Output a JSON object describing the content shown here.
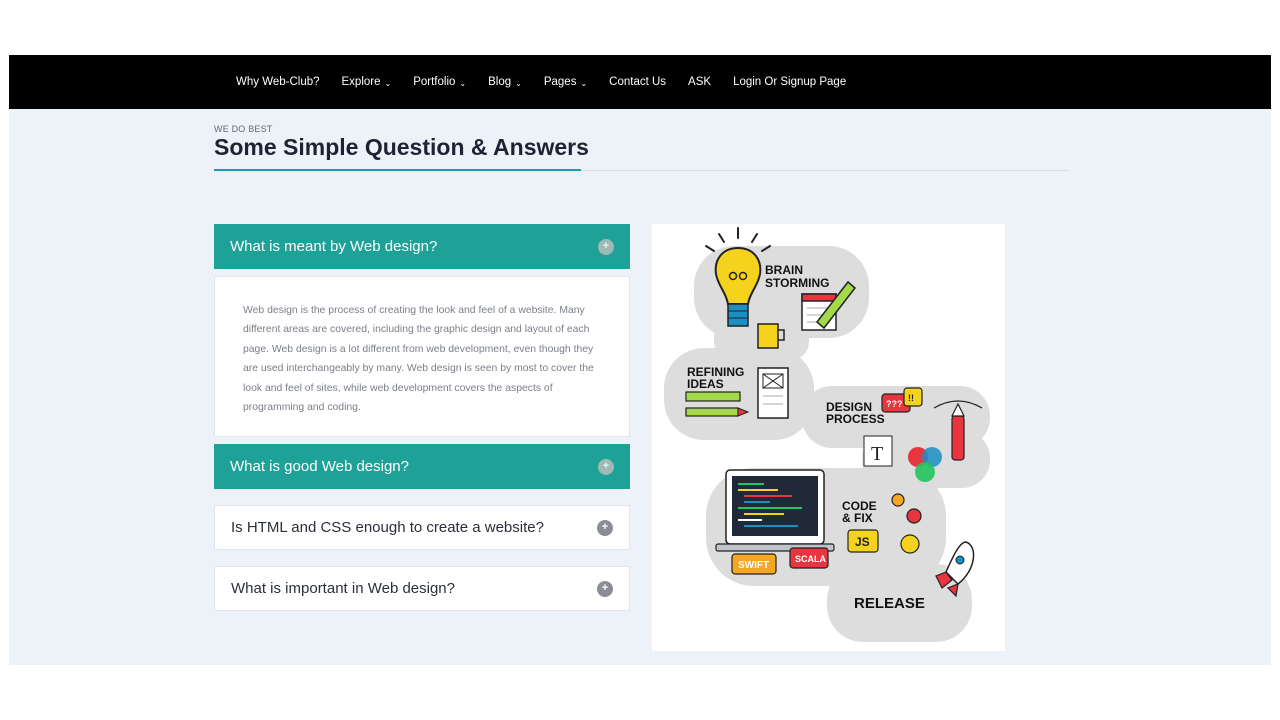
{
  "nav": {
    "items": [
      {
        "label": "Why Web-Club?",
        "dropdown": false
      },
      {
        "label": "Explore",
        "dropdown": true
      },
      {
        "label": "Portfolio",
        "dropdown": true
      },
      {
        "label": "Blog",
        "dropdown": true
      },
      {
        "label": "Pages",
        "dropdown": true
      },
      {
        "label": "Contact Us",
        "dropdown": false
      },
      {
        "label": "ASK",
        "dropdown": false
      },
      {
        "label": "Login Or Signup Page",
        "dropdown": false
      }
    ],
    "caret": "⌄"
  },
  "section": {
    "eyebrow": "WE DO BEST",
    "title": "Some Simple Question & Answers"
  },
  "faq": {
    "items": [
      {
        "question": "What is meant by Web design?",
        "expanded": true
      },
      {
        "question": "What is good Web design?",
        "expanded": false
      },
      {
        "question": "Is HTML and CSS enough to create a website?",
        "expanded": false
      },
      {
        "question": "What is important in Web design?",
        "expanded": false
      }
    ],
    "answer_lines": [
      "Web design is the process of creating the look and feel of a website. Many",
      "different areas are covered, including the graphic design and layout of each",
      "page. Web design is a lot different from web development, even though they",
      "are used interchangeably by many. Web design is seen by most to cover the",
      "look and feel of sites, while web development covers the aspects of",
      "programming and coding."
    ],
    "toggle_glyph": "+"
  },
  "illustration": {
    "labels": {
      "brainstorming_1": "BRAIN",
      "brainstorming_2": "STORMING",
      "refining_1": "REFINING",
      "refining_2": "IDEAS",
      "design_1": "DESIGN",
      "design_2": "PROCESS",
      "bubble": "???",
      "bubble2": "!!",
      "text_tool": "T",
      "code_1": "CODE",
      "code_2": "& FIX",
      "js": "JS",
      "swift": "SWIFT",
      "scala": "SCALA",
      "release": "RELEASE"
    },
    "colors": {
      "blob": "#dddddd",
      "yellow": "#f5d21c",
      "red": "#e8353f",
      "green": "#22c55e",
      "teal": "#1ea196"
    }
  }
}
